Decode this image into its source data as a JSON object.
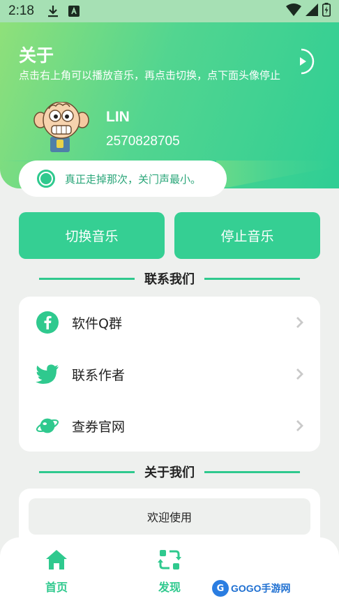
{
  "status_bar": {
    "time": "2:18",
    "icons_left": [
      "download-icon",
      "app-notification-icon"
    ],
    "icons_right": [
      "wifi-icon",
      "signal-icon",
      "battery-icon"
    ]
  },
  "header": {
    "title": "关于",
    "subtitle": "点击右上角可以播放音乐，再点击切换，点下面头像停止",
    "user_name": "LIN",
    "user_id": "2570828705"
  },
  "quote": {
    "text": "真正走掉那次，关门声最小。"
  },
  "buttons": {
    "switch_music": "切换音乐",
    "stop_music": "停止音乐"
  },
  "contact_section": {
    "title": "联系我们",
    "items": [
      {
        "icon": "facebook-icon",
        "label": "软件Q群"
      },
      {
        "icon": "twitter-icon",
        "label": "联系作者"
      },
      {
        "icon": "planet-icon",
        "label": "查券官网"
      }
    ]
  },
  "about_section": {
    "title": "关于我们",
    "welcome": "欢迎使用"
  },
  "bottom_nav": {
    "items": [
      {
        "icon": "home-icon",
        "label": "首页"
      },
      {
        "icon": "refresh-icon",
        "label": "发现"
      }
    ]
  },
  "watermark": {
    "text": "GOGO手游网"
  },
  "colors": {
    "accent": "#35cf93",
    "gradient_start": "#8fe07a",
    "gradient_end": "#2fce94"
  }
}
